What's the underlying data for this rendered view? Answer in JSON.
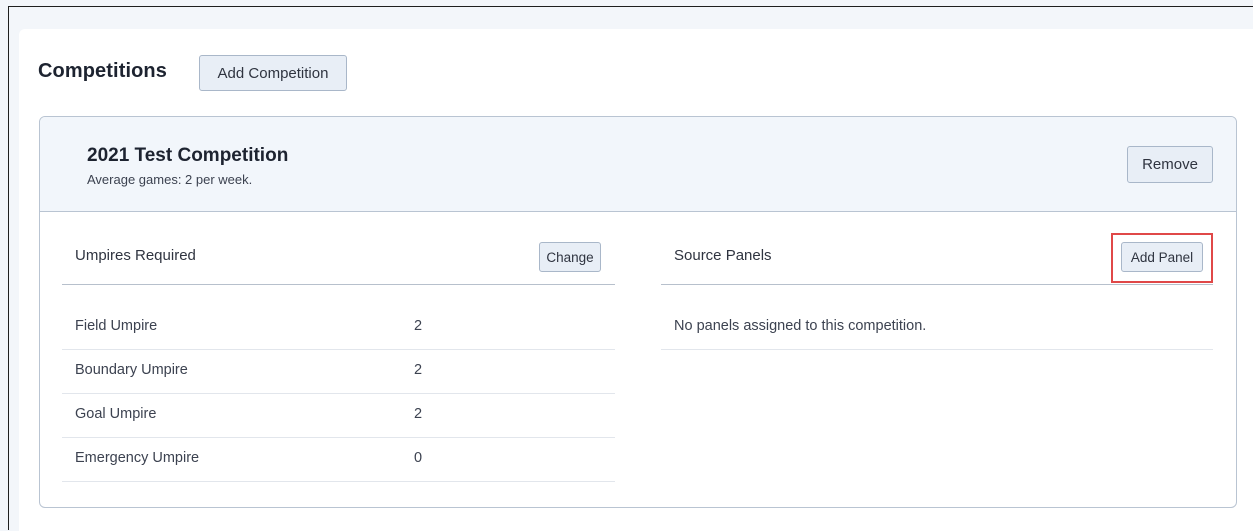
{
  "header": {
    "title": "Competitions",
    "add_competition_label": "Add Competition"
  },
  "competition": {
    "name": "2021 Test Competition",
    "subtitle": "Average games: 2 per week.",
    "remove_label": "Remove"
  },
  "umpires": {
    "title": "Umpires Required",
    "change_label": "Change",
    "rows": [
      {
        "label": "Field Umpire",
        "value": "2"
      },
      {
        "label": "Boundary Umpire",
        "value": "2"
      },
      {
        "label": "Goal Umpire",
        "value": "2"
      },
      {
        "label": "Emergency Umpire",
        "value": "0"
      }
    ]
  },
  "panels": {
    "title": "Source Panels",
    "add_panel_label": "Add Panel",
    "empty_message": "No panels assigned to this competition."
  },
  "colors": {
    "highlight": "#e04848",
    "button_bg": "#e8eef6",
    "header_bg": "#f2f6fb"
  }
}
